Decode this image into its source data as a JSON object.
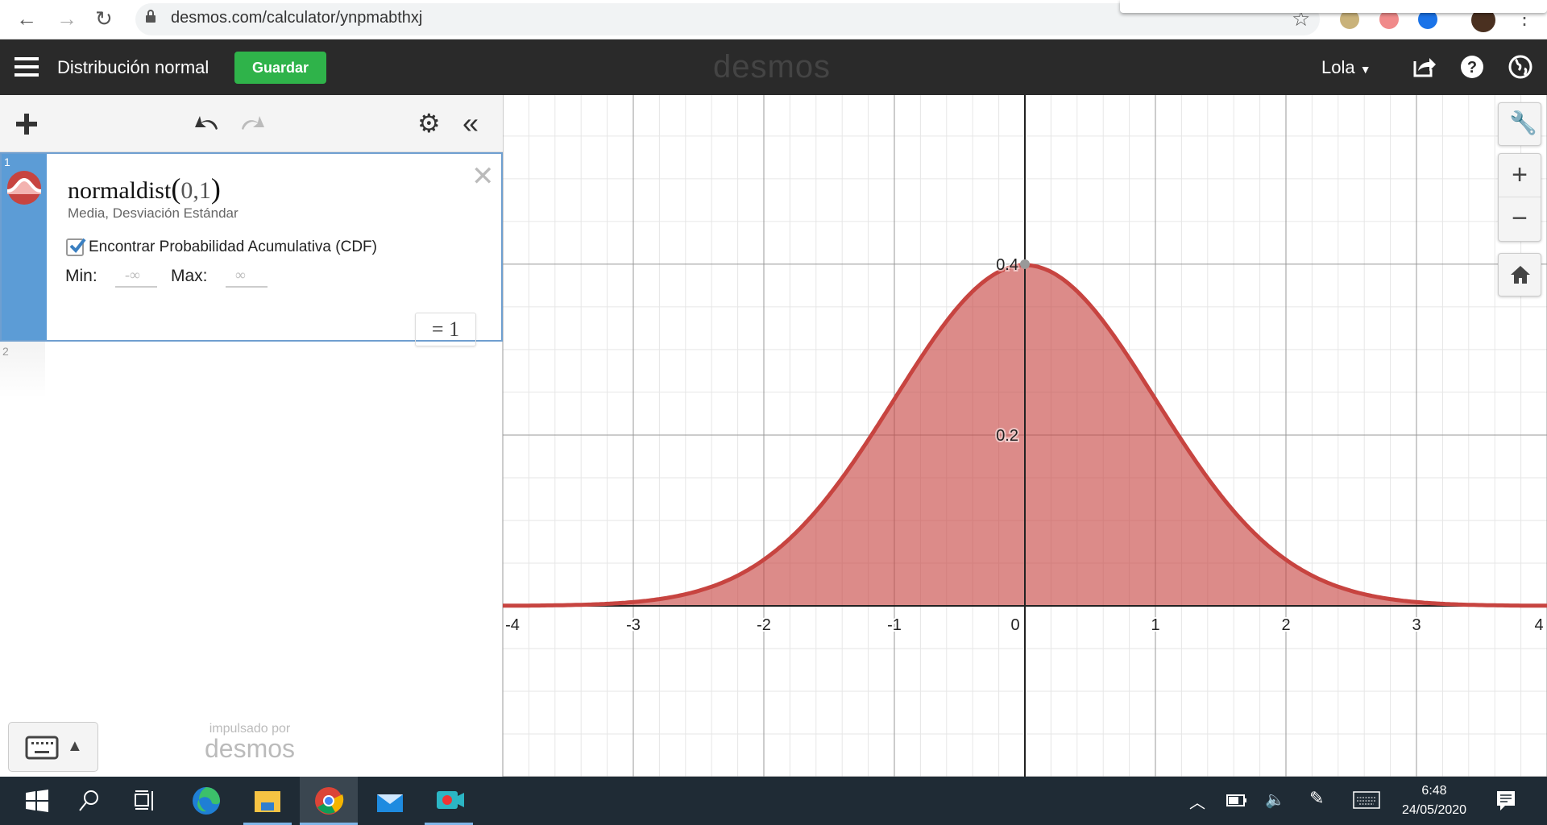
{
  "browser": {
    "url": "desmos.com/calculator/ynpmabthxj"
  },
  "header": {
    "title": "Distribución normal",
    "save_label": "Guardar",
    "logo": "desmos",
    "user": "Lola"
  },
  "expressions": [
    {
      "index": "1",
      "function": "normaldist",
      "args": "0,1",
      "hint": "Media, Desviación Estándar",
      "cdf_label": "Encontrar Probabilidad Acumulativa (CDF)",
      "cdf_checked": true,
      "min_label": "Min:",
      "min_value": "-∞",
      "max_label": "Max:",
      "max_value": "∞",
      "result": "= 1",
      "color": "#c74440"
    },
    {
      "index": "2"
    }
  ],
  "powered": {
    "line1": "impulsado por",
    "line2": "desmos"
  },
  "graph": {
    "xrange": [
      -4,
      4
    ],
    "yrange": [
      -0.2,
      0.598
    ],
    "x_ticks": [
      "-4",
      "-3",
      "-2",
      "-1",
      "0",
      "1",
      "2",
      "3",
      "4"
    ],
    "y_ticks": [
      "0.2",
      "0.4"
    ],
    "curve": {
      "type": "normal_pdf",
      "mean": 0,
      "sd": 1,
      "shaded_from": "-inf",
      "shaded_to": "inf",
      "color": "#c74440"
    },
    "point": {
      "x": 0,
      "y": 0.4
    }
  },
  "taskbar": {
    "time": "6:48",
    "date": "24/05/2020"
  }
}
